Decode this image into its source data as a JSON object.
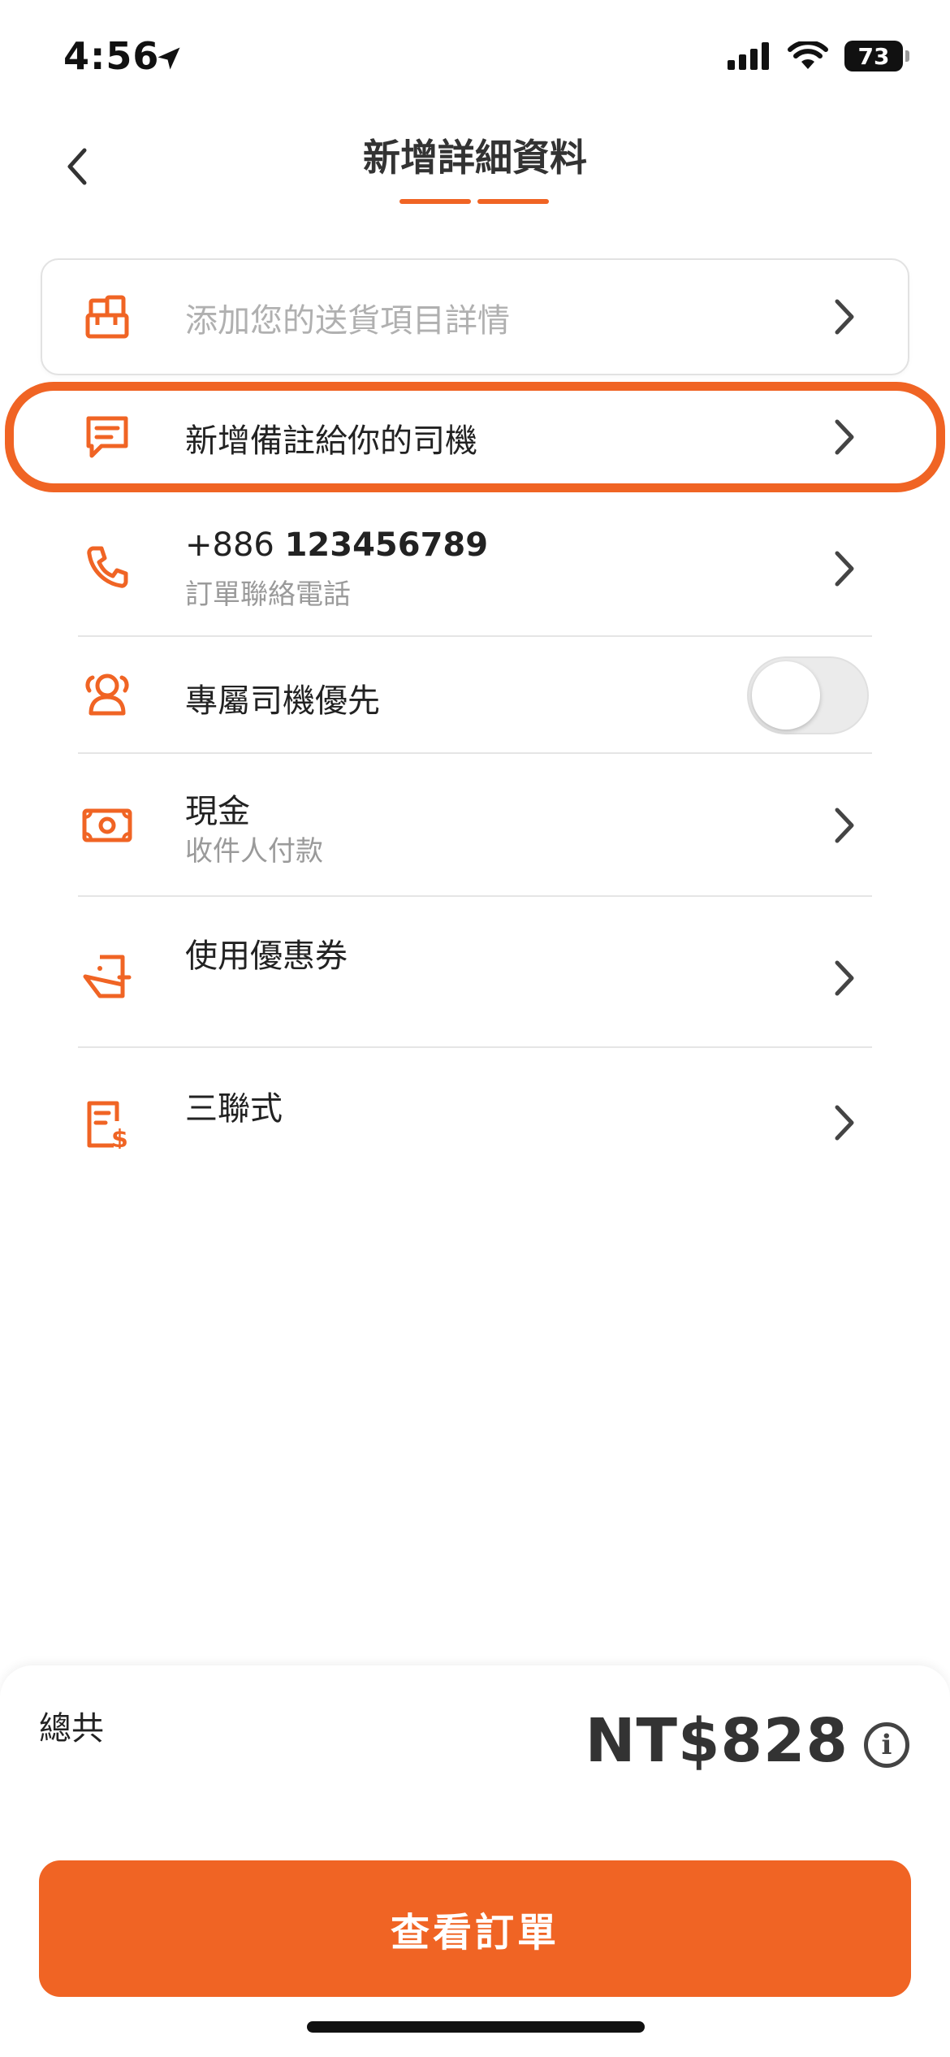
{
  "status_bar": {
    "time": "4:56",
    "battery": "73"
  },
  "header": {
    "title": "新增詳細資料"
  },
  "items": {
    "delivery_details": {
      "placeholder": "添加您的送貨項目詳情"
    },
    "driver_note": {
      "label": "新增備註給你的司機"
    },
    "phone": {
      "country_code": "+886",
      "number": "123456789",
      "subtitle": "訂單聯絡電話"
    },
    "priority_driver": {
      "label": "專屬司機優先",
      "enabled": false
    },
    "payment": {
      "label": "現金",
      "subtitle": "收件人付款"
    },
    "coupon": {
      "label": "使用優惠券"
    },
    "invoice": {
      "label": "三聯式"
    }
  },
  "footer": {
    "total_label": "總共",
    "total_amount": "NT$828",
    "cta_label": "查看訂單"
  },
  "colors": {
    "accent": "#f06424",
    "text": "#222222",
    "muted": "#9a9a9a"
  }
}
